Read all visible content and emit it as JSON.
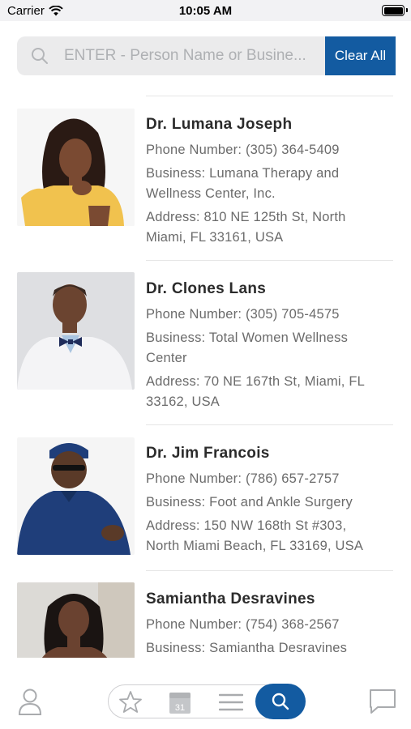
{
  "status_bar": {
    "carrier": "Carrier",
    "time": "10:05 AM"
  },
  "search": {
    "placeholder": "ENTER - Person Name or Busine...",
    "value": "",
    "clear_label": "Clear All"
  },
  "results": [
    {
      "name": "Dr. Lumana Joseph",
      "phone_line": "Phone Number: (305) 364-5409",
      "business_line_1": "Business: Lumana Therapy and",
      "business_line_2": "Wellness Center, Inc.",
      "address_line_1": "Address: 810 NE 125th St, North",
      "address_line_2": "Miami, FL 33161, USA"
    },
    {
      "name": "Dr. Clones Lans",
      "phone_line": "Phone Number: (305) 705-4575",
      "business_line_1": "Business: Total Women Wellness",
      "business_line_2": "Center",
      "address_line_1": "Address: 70 NE 167th St, Miami, FL",
      "address_line_2": "33162, USA"
    },
    {
      "name": "Dr. Jim Francois",
      "phone_line": "Phone Number: (786) 657-2757",
      "business_line_1": "Business: Foot and Ankle Surgery",
      "address_line_1": "Address: 150 NW 168th St #303,",
      "address_line_2": "North Miami Beach, FL 33169, USA"
    },
    {
      "name": "Samiantha Desravines",
      "phone_line": "Phone Number: (754) 368-2567",
      "business_line_1": "Business: Samiantha Desravines"
    }
  ],
  "tabbar": {
    "calendar_day": "31",
    "icons": [
      "profile-icon",
      "star-icon",
      "calendar-icon",
      "menu-icon",
      "search-icon",
      "chat-icon"
    ]
  },
  "colors": {
    "accent": "#135ba1",
    "search_bg": "#ebebec",
    "text_muted": "#6b6b6b"
  }
}
